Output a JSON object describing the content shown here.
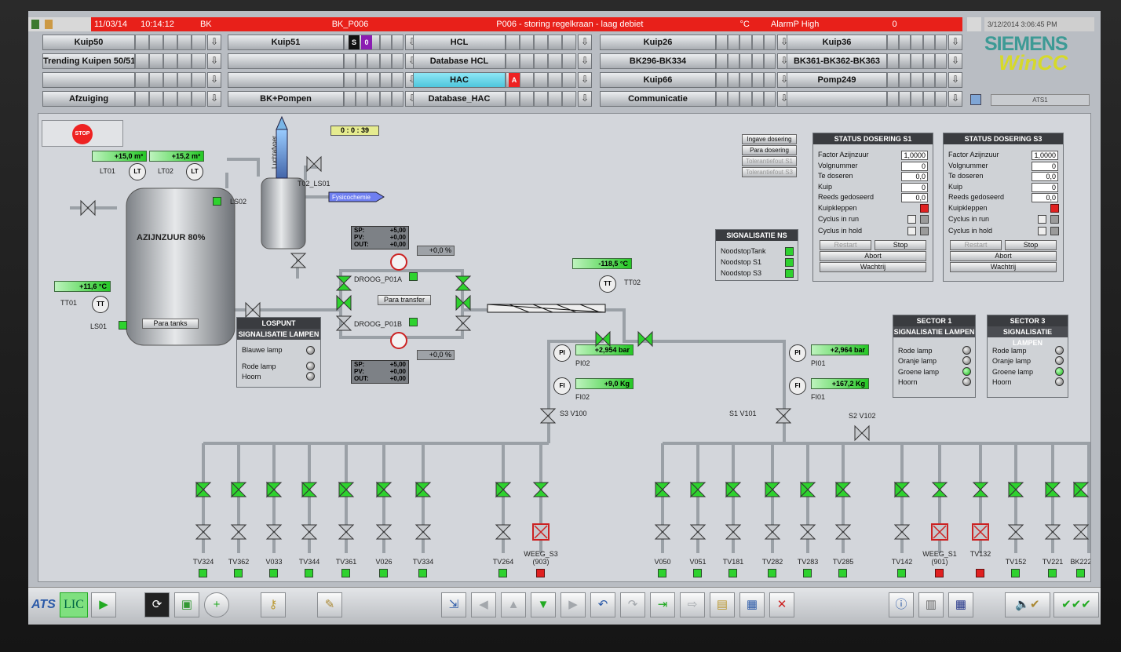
{
  "alarm_bar": {
    "date": "11/03/14",
    "time": "10:14:12",
    "area": "BK",
    "tag": "BK_P006",
    "message": "P006 - storing regelkraan - laag debiet",
    "unit": "°C",
    "class": "AlarmP High",
    "count": "0",
    "system_time": "3/12/2014 3:06:45 PM"
  },
  "nav": {
    "col1": [
      "Kuip50",
      "Trending Kuipen 50/51",
      "",
      "Afzuiging"
    ],
    "col2": [
      "Kuip51",
      "",
      "",
      "BK+Pompen"
    ],
    "col3": [
      "HCL",
      "Database HCL",
      "HAC",
      "Database_HAC"
    ],
    "col4": [
      "Kuip26",
      "BK296-BK334",
      "Kuip66",
      "Communicatie"
    ],
    "col5": [
      "Kuip36",
      "BK361-BK362-BK363",
      "Pomp249",
      ""
    ],
    "kuip51_flags": [
      "S",
      "0"
    ],
    "hac_flag": "A",
    "arrow": "⇩"
  },
  "brand": {
    "siemens": "SIEMENS",
    "wincc": "WinCC",
    "station": "ATS1"
  },
  "process": {
    "stop_label": "STOP",
    "timer": "0 : 0 : 39",
    "tank": {
      "name": "AZIJNZUUR 80%",
      "para_button": "Para tanks",
      "lt01_value": "+15,0  m³",
      "lt02_value": "+15,2  m³",
      "lt01": "LT01",
      "lt02": "LT02",
      "ls02": "LS02",
      "ls01": "LS01",
      "tt01": "TT01",
      "tt01_value": "+11,6  °C",
      "lt": "LT",
      "tt": "TT"
    },
    "vessel": {
      "label": "T02_LS01",
      "luchtafvoer": "Luchtafvoer",
      "fysicochemie": "Fysicochemie"
    },
    "pid_top": {
      "sp": "+5,00",
      "pv": "+0,00",
      "out": "+0,00",
      "sp_lbl": "SP:",
      "pv_lbl": "PV:",
      "out_lbl": "OUT:",
      "pct": "+0,0 %"
    },
    "pid_bottom": {
      "sp": "+5,00",
      "pv": "+0,00",
      "out": "+0,00",
      "sp_lbl": "SP:",
      "pv_lbl": "PV:",
      "out_lbl": "OUT:",
      "pct": "+0,0 %"
    },
    "pumps": {
      "p01a": "DROOG_P01A",
      "p01b": "DROOG_P01B",
      "transfer_button": "Para transfer"
    },
    "tt02": {
      "label": "TT02",
      "value": "-118,5  °C",
      "sym": "TT"
    },
    "pi02": {
      "label": "PI02",
      "value": "+2,954  bar",
      "sym": "PI"
    },
    "fi02": {
      "label": "FI02",
      "value": "+9,0  Kg",
      "sym": "FI"
    },
    "pi01": {
      "label": "PI01",
      "value": "+2,964  bar",
      "sym": "PI"
    },
    "fi01": {
      "label": "FI01",
      "value": "+167,2  Kg",
      "sym": "FI"
    },
    "valves": {
      "s3v100": "S3 V100",
      "s1v101": "S1 V101",
      "s2v102": "S2 V102"
    },
    "lospunt": {
      "title": "LOSPUNT",
      "subtitle": "SIGNALISATIE LAMPEN",
      "rows": [
        "Blauwe lamp",
        "Rode lamp",
        "Hoorn"
      ]
    },
    "dosing_buttons": [
      "Ingave dosering",
      "Para dosering",
      "Tolerantiefout S1",
      "Tolerantiefout S3"
    ],
    "signalisatie_ns": {
      "title": "SIGNALISATIE NS",
      "rows": [
        "NoodstopTank",
        "Noodstop S1",
        "Noodstop S3"
      ]
    },
    "status_s1": {
      "title": "STATUS DOSERING S1",
      "rows": [
        {
          "label": "Factor Azijnzuur",
          "value": "1,0000"
        },
        {
          "label": "Volgnummer",
          "value": "0"
        },
        {
          "label": "Te doseren",
          "value": "0,0"
        },
        {
          "label": "Kuip",
          "value": "0"
        },
        {
          "label": "Reeds gedoseerd",
          "value": "0,0"
        }
      ],
      "kuipkleppen": "Kuipkleppen",
      "cyclus_run": "Cyclus in run",
      "cyclus_hold": "Cyclus in hold",
      "restart": "Restart",
      "stop": "Stop",
      "abort": "Abort",
      "wachtrij": "Wachtrij"
    },
    "status_s3": {
      "title": "STATUS DOSERING S3",
      "rows": [
        {
          "label": "Factor Azijnzuur",
          "value": "1,0000"
        },
        {
          "label": "Volgnummer",
          "value": "0"
        },
        {
          "label": "Te doseren",
          "value": "0,0"
        },
        {
          "label": "Kuip",
          "value": "0"
        },
        {
          "label": "Reeds gedoseerd",
          "value": "0,0"
        }
      ],
      "kuipkleppen": "Kuipkleppen",
      "cyclus_run": "Cyclus in run",
      "cyclus_hold": "Cyclus in hold",
      "restart": "Restart",
      "stop": "Stop",
      "abort": "Abort",
      "wachtrij": "Wachtrij"
    },
    "sector1": {
      "title": "SECTOR 1",
      "subtitle": "SIGNALISATIE LAMPEN",
      "rows": [
        "Rode lamp",
        "Oranje lamp",
        "Groene lamp",
        "Hoorn"
      ]
    },
    "sector3": {
      "title": "SECTOR 3",
      "subtitle": "SIGNALISATIE LAMPEN",
      "rows": [
        "Rode lamp",
        "Oranje lamp",
        "Groene lamp",
        "Hoorn"
      ]
    },
    "drops_left": [
      "TV324",
      "TV362",
      "V033",
      "TV344",
      "TV361",
      "V026",
      "TV334",
      "TV264",
      "WEEG_S3"
    ],
    "weeg_s3_sub": "(903)",
    "drops_right": [
      "V050",
      "V051",
      "TV181",
      "TV282",
      "TV283",
      "TV285",
      "TV142",
      "WEEG_S1",
      "TV132",
      "TV152",
      "TV221",
      "BK222"
    ],
    "weeg_s1_sub": "(901)"
  },
  "toolbar": {
    "lic": "LIC",
    "ats": "ATS"
  },
  "colors": {
    "alarm_red": "#e8201a",
    "active_cyan": "#5fd2e6",
    "green_ok": "#2ed22e",
    "siemens_green": "#3d9a95",
    "wincc_yellow": "#d6d92a"
  }
}
